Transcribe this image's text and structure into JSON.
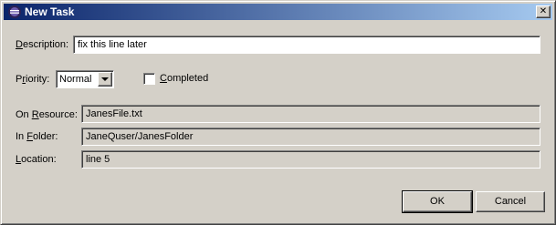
{
  "window": {
    "title": "New Task",
    "close_glyph": "✕",
    "app_icon": "eclipse-icon"
  },
  "form": {
    "description": {
      "label_mnemonic": "D",
      "label_rest": "escription:",
      "value": "fix this line later"
    },
    "priority": {
      "label_pre": "P",
      "label_mnemonic": "r",
      "label_rest": "iority:",
      "value": "Normal"
    },
    "completed": {
      "label_mnemonic": "C",
      "label_rest": "ompleted",
      "checked": false
    },
    "on_resource": {
      "label_pre": "On ",
      "label_mnemonic": "R",
      "label_rest": "esource:",
      "value": "JanesFile.txt"
    },
    "in_folder": {
      "label_pre": "In ",
      "label_mnemonic": "F",
      "label_rest": "older:",
      "value": "JaneQuser/JanesFolder"
    },
    "location": {
      "label_mnemonic": "L",
      "label_rest": "ocation:",
      "value": "line 5"
    }
  },
  "buttons": {
    "ok": "OK",
    "cancel": "Cancel"
  }
}
